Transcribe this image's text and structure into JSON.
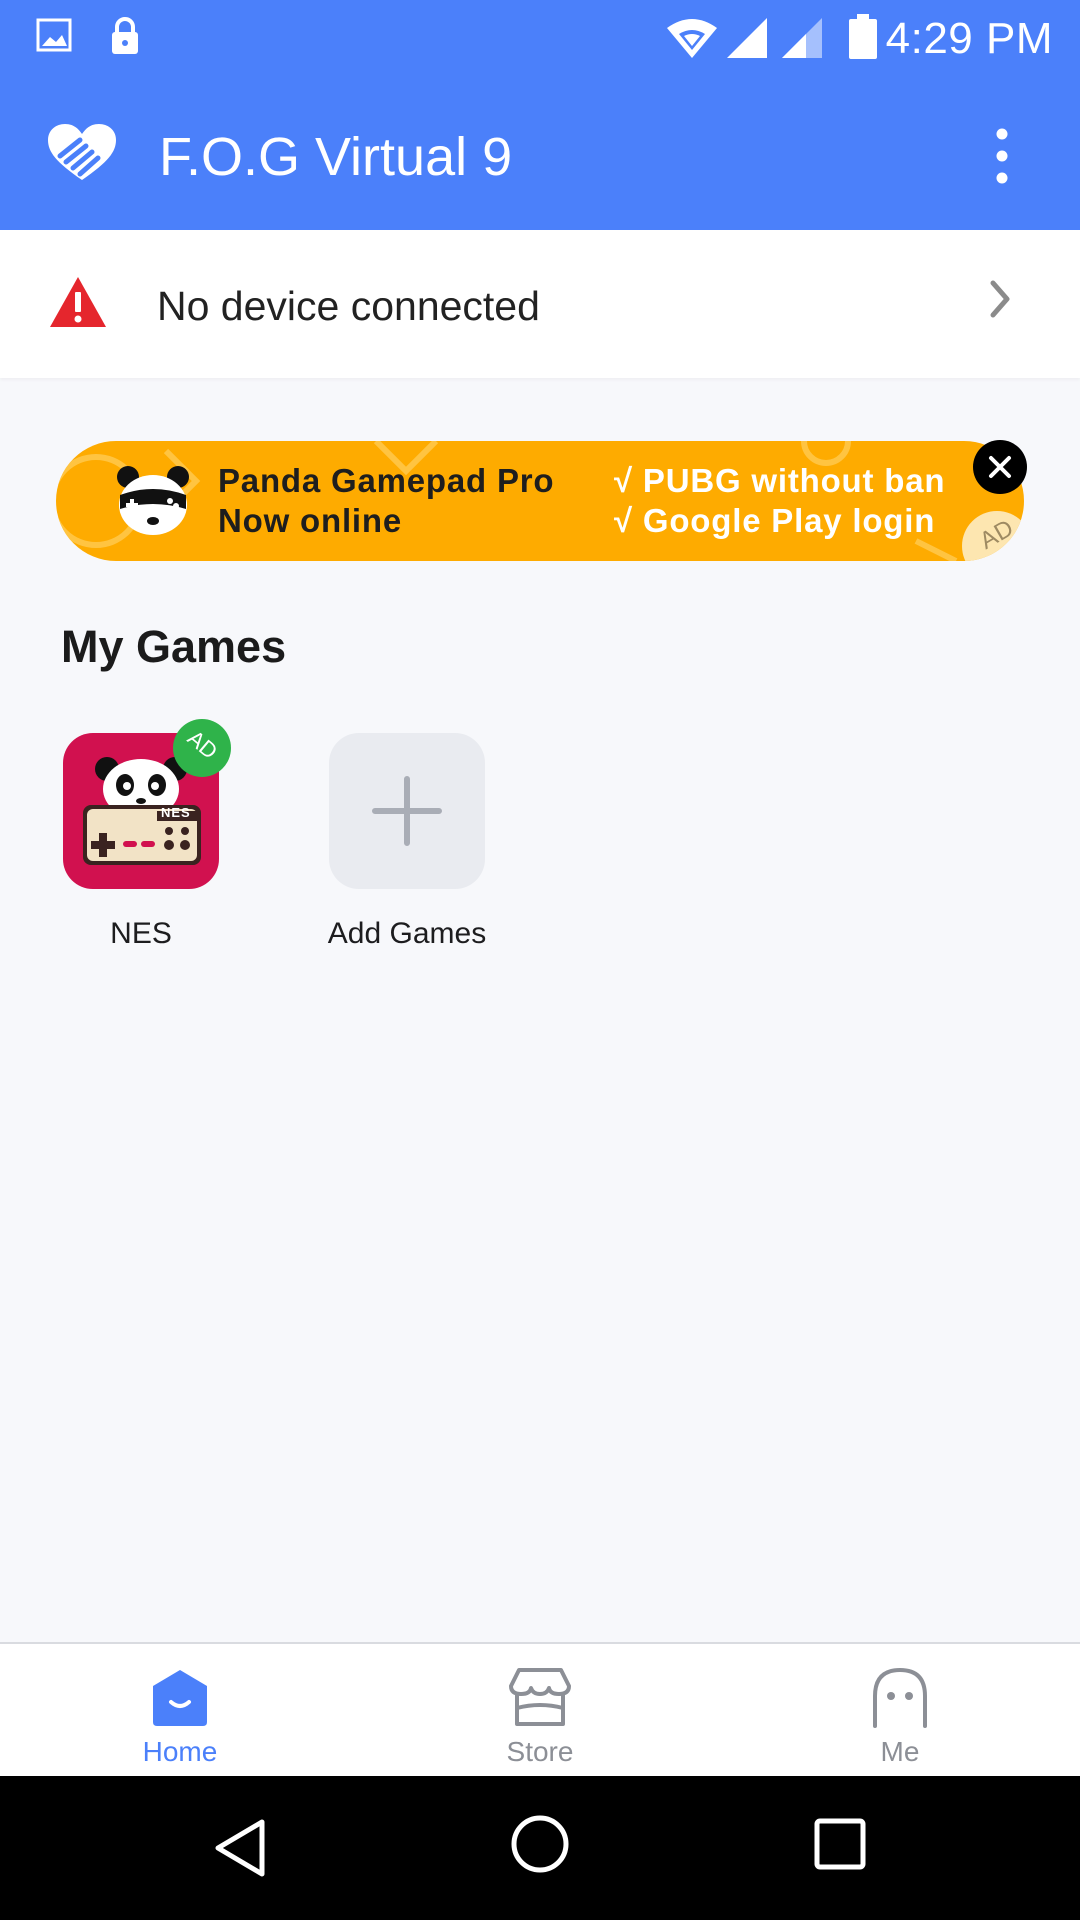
{
  "colors": {
    "primary": "#4b80fa",
    "ad_orange": "#feab00",
    "warning_red": "#e5262d",
    "nes_red": "#d1114f",
    "ad_badge_green": "#2fb34a",
    "inactive_gray": "#8c8f96"
  },
  "status_bar": {
    "time": "4:29 PM",
    "icons": [
      "image-icon",
      "lock-icon",
      "wifi-icon",
      "signal-icon",
      "signal-icon",
      "battery-icon"
    ]
  },
  "app_bar": {
    "title": "F.O.G Virtual 9",
    "logo_icon": "heart-hand-logo-icon",
    "menu_icon": "more-vert-icon"
  },
  "device_status": {
    "text": "No device connected",
    "icon": "warning-icon",
    "action_icon": "chevron-right-icon"
  },
  "ad_banner": {
    "title": "Panda Gamepad Pro",
    "subtitle": "Now online",
    "features": [
      "√ PUBG without ban",
      "√ Google Play login"
    ],
    "corner_label": "AD",
    "close_icon": "close-icon"
  },
  "my_games": {
    "title": "My Games",
    "items": [
      {
        "label": "NES",
        "badge": "AD",
        "icon_text": "NES",
        "icon": "nes-controller-panda-icon"
      },
      {
        "label": "Add Games",
        "icon": "plus-icon"
      }
    ]
  },
  "bottom_nav": {
    "items": [
      {
        "label": "Home",
        "icon": "home-icon",
        "active": true
      },
      {
        "label": "Store",
        "icon": "store-icon",
        "active": false
      },
      {
        "label": "Me",
        "icon": "ghost-profile-icon",
        "active": false
      }
    ]
  },
  "system_nav": {
    "icons": [
      "back-icon",
      "home-circle-icon",
      "recents-icon"
    ]
  }
}
